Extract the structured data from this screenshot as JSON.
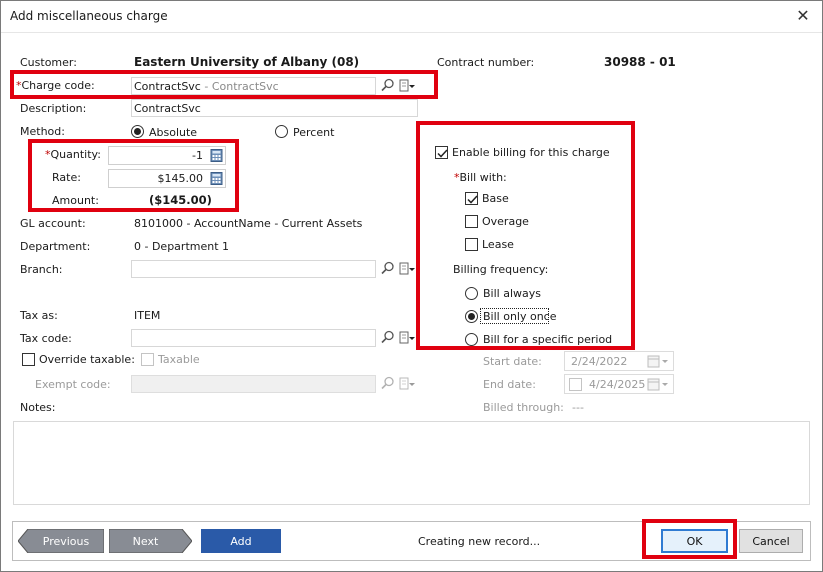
{
  "window": {
    "title": "Add miscellaneous charge",
    "close_glyph": "✕"
  },
  "customer": {
    "label": "Customer:",
    "value": "Eastern University of Albany (08)"
  },
  "contract": {
    "label": "Contract number:",
    "value": "30988 - 01"
  },
  "charge_code": {
    "required_mark": "*",
    "label": "Charge code:",
    "value": "ContractSvc",
    "sub_value": " - ContractSvc"
  },
  "description": {
    "label": "Description:",
    "value": "ContractSvc"
  },
  "method": {
    "label": "Method:",
    "options": [
      "Absolute",
      "Percent"
    ],
    "selected": "Absolute"
  },
  "quantity": {
    "required_mark": "*",
    "label": "Quantity:",
    "value": "-1"
  },
  "rate": {
    "label": "Rate:",
    "value": "$145.00"
  },
  "amount": {
    "label": "Amount:",
    "value": "($145.00)"
  },
  "gl_account": {
    "label": "GL account:",
    "value": "8101000 - AccountName - Current Assets"
  },
  "department": {
    "label": "Department:",
    "value": "0 - Department 1"
  },
  "branch": {
    "label": "Branch:",
    "value": ""
  },
  "tax_as": {
    "label": "Tax as:",
    "value": "ITEM"
  },
  "tax_code": {
    "label": "Tax code:",
    "value": ""
  },
  "override_taxable": {
    "label": "Override taxable:",
    "checked": false
  },
  "taxable": {
    "label": "Taxable",
    "checked": false
  },
  "exempt_code": {
    "label": "Exempt code:",
    "value": ""
  },
  "notes": {
    "label": "Notes:",
    "value": ""
  },
  "billing": {
    "enable_label": "Enable billing for this charge",
    "enabled": true,
    "bill_with_required": "*",
    "bill_with_label": "Bill with:",
    "bill_with": [
      {
        "label": "Base",
        "checked": true
      },
      {
        "label": "Overage",
        "checked": false
      },
      {
        "label": "Lease",
        "checked": false
      }
    ],
    "frequency_label": "Billing frequency:",
    "frequency": [
      {
        "label": "Bill always",
        "selected": false
      },
      {
        "label": "Bill only once",
        "selected": true
      },
      {
        "label": "Bill for a specific period",
        "selected": false
      }
    ],
    "start_date": {
      "label": "Start date:",
      "value": "2/24/2022"
    },
    "end_date": {
      "label": "End date:",
      "value": "4/24/2025"
    },
    "billed_through": {
      "label": "Billed through:",
      "value": "---"
    }
  },
  "footer": {
    "previous": "Previous",
    "next": "Next",
    "add": "Add",
    "status": "Creating new record...",
    "ok": "OK",
    "cancel": "Cancel"
  },
  "colors": {
    "highlight": "#e0000f",
    "primary_button": "#2a5aa8",
    "nav_button": "#888c94",
    "ok_border": "#2f7bd2"
  },
  "icons": [
    "close-icon",
    "search-icon",
    "document-dropdown-icon",
    "calculator-icon",
    "calendar-icon",
    "checkmark-icon"
  ]
}
